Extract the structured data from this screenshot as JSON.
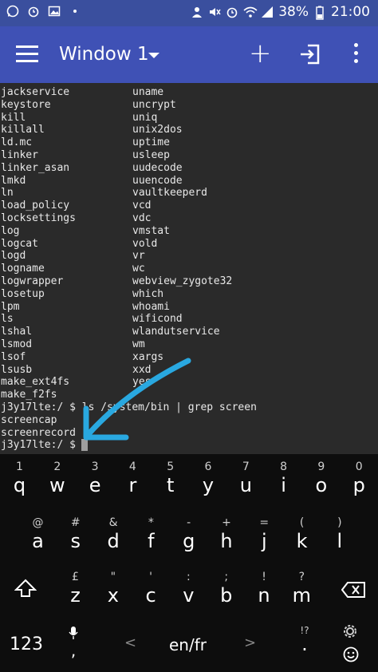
{
  "status": {
    "battery": "38%",
    "time": "21:00"
  },
  "appbar": {
    "title": "Window 1"
  },
  "terminal": {
    "col1": [
      "jackservice",
      "keystore",
      "kill",
      "killall",
      "ld.mc",
      "linker",
      "linker_asan",
      "lmkd",
      "ln",
      "load_policy",
      "locksettings",
      "log",
      "logcat",
      "logd",
      "logname",
      "logwrapper",
      "losetup",
      "lpm",
      "ls",
      "lshal",
      "lsmod",
      "lsof",
      "lsusb",
      "make_ext4fs",
      "make_f2fs"
    ],
    "col2": [
      "uname",
      "uncrypt",
      "uniq",
      "unix2dos",
      "uptime",
      "usleep",
      "uudecode",
      "uuencode",
      "vaultkeeperd",
      "vcd",
      "vdc",
      "vmstat",
      "vold",
      "vr",
      "wc",
      "webview_zygote32",
      "which",
      "whoami",
      "wificond",
      "wlandutservice",
      "wm",
      "xargs",
      "xxd",
      "yes",
      ""
    ],
    "command_line": "j3y17lte:/ $ ls /system/bin | grep screen",
    "results": [
      "screencap",
      "screenrecord"
    ],
    "prompt": "j3y17lte:/ $ "
  },
  "keyboard": {
    "number_hints": [
      "1",
      "2",
      "3",
      "4",
      "5",
      "6",
      "7",
      "8",
      "9",
      "0"
    ],
    "row1": [
      "q",
      "w",
      "e",
      "r",
      "t",
      "y",
      "u",
      "i",
      "o",
      "p"
    ],
    "row2_hints": [
      "@",
      "#",
      "&",
      "*",
      "-",
      "+",
      "=",
      "(",
      ")"
    ],
    "row2": [
      "a",
      "s",
      "d",
      "f",
      "g",
      "h",
      "j",
      "k",
      "l"
    ],
    "row3_hints": [
      "",
      "£",
      "\"",
      "'",
      ":",
      ";",
      "!",
      "?"
    ],
    "row3": [
      "z",
      "x",
      "c",
      "v",
      "b",
      "n",
      "m"
    ],
    "numbers_key": "123",
    "language": "en/fr",
    "space_left": "<",
    "space_right": ">",
    "comma_hint": ",",
    "period": ".",
    "punct_hint": "!?"
  },
  "colors": {
    "statusbar": "#3a4f9e",
    "appbar": "#3f51b5",
    "terminal_bg": "#2a2a2a",
    "arrow": "#29a8e0"
  }
}
